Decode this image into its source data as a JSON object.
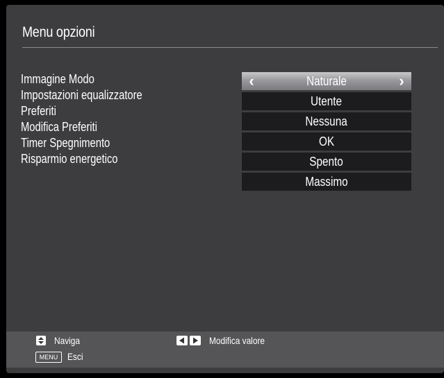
{
  "menu": {
    "title": "Menu opzioni",
    "items": [
      {
        "label": "Immagine Modo",
        "value": "Naturale",
        "selected": true
      },
      {
        "label": "Impostazioni equalizzatore",
        "value": "Utente",
        "selected": false
      },
      {
        "label": "Preferiti",
        "value": "Nessuna",
        "selected": false
      },
      {
        "label": "Modifica Preferiti",
        "value": "OK",
        "selected": false
      },
      {
        "label": "Timer Spegnimento",
        "value": "Spento",
        "selected": false
      },
      {
        "label": "Risparmio energetico",
        "value": "Massimo",
        "selected": false
      }
    ]
  },
  "footer": {
    "navigate_label": "Naviga",
    "navigate_icon": "up-down-arrows-icon",
    "change_label": "Modifica valore",
    "change_icon": "left-right-arrows-icon",
    "exit_key": "MENU",
    "exit_label": "Esci"
  },
  "colors": {
    "panel": "#3d3d40",
    "value_box": "#1c1c1e",
    "footer": "#555558",
    "text": "#ffffff"
  }
}
